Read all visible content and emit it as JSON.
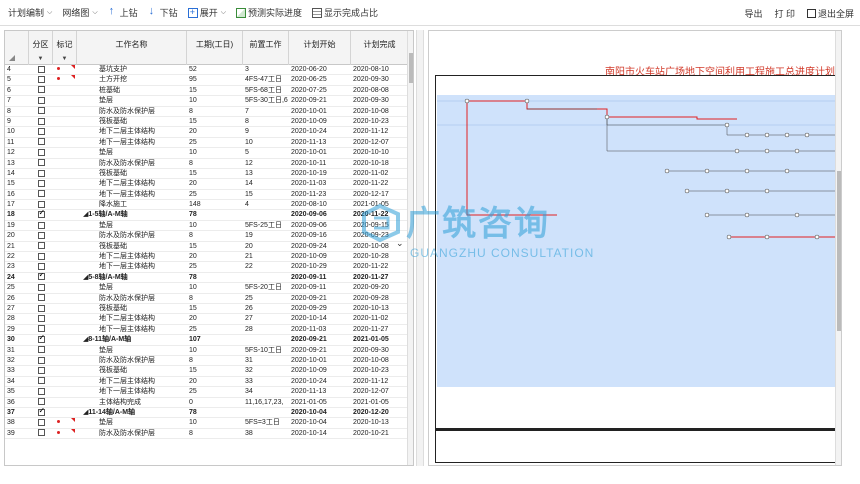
{
  "toolbar": {
    "plan_edit": "计划编制",
    "network": "网络图",
    "drill_up": "上钻",
    "drill_down": "下钻",
    "expand": "展开",
    "predict": "预测实际进度",
    "show_ratio": "显示完成占比",
    "export": "导出",
    "print": "打 印",
    "exit_full": "退出全屏"
  },
  "columns": {
    "part": "分区",
    "mark": "标记",
    "name": "工作名称",
    "duration": "工期(工日)",
    "predecessor": "前置工作",
    "start": "计划开始",
    "end": "计划完成"
  },
  "rows": [
    {
      "n": "4",
      "name": "基坑支护",
      "dur": "52",
      "pre": "3",
      "start": "2020-06-20",
      "end": "2020-08-10",
      "mark": true,
      "bold": false,
      "check": false
    },
    {
      "n": "5",
      "name": "土方开挖",
      "dur": "95",
      "pre": "4FS-47工日",
      "start": "2020-06-25",
      "end": "2020-09-30",
      "mark": true,
      "bold": false,
      "check": false
    },
    {
      "n": "6",
      "name": "桩基础",
      "dur": "15",
      "pre": "5FS-68工日",
      "start": "2020-07-25",
      "end": "2020-08-08",
      "mark": false,
      "bold": false,
      "check": false
    },
    {
      "n": "7",
      "name": "垫层",
      "dur": "10",
      "pre": "5FS-30工日,6",
      "start": "2020-09-21",
      "end": "2020-09-30",
      "mark": false,
      "bold": false,
      "check": false
    },
    {
      "n": "8",
      "name": "防水及防水保护层",
      "dur": "8",
      "pre": "7",
      "start": "2020-10-01",
      "end": "2020-10-08",
      "mark": false,
      "bold": false,
      "check": false
    },
    {
      "n": "9",
      "name": "筏板基础",
      "dur": "15",
      "pre": "8",
      "start": "2020-10-09",
      "end": "2020-10-23",
      "mark": false,
      "bold": false,
      "check": false
    },
    {
      "n": "10",
      "name": "地下二层主体结构",
      "dur": "20",
      "pre": "9",
      "start": "2020-10-24",
      "end": "2020-11-12",
      "mark": false,
      "bold": false,
      "check": false
    },
    {
      "n": "11",
      "name": "地下一层主体结构",
      "dur": "25",
      "pre": "10",
      "start": "2020-11-13",
      "end": "2020-12-07",
      "mark": false,
      "bold": false,
      "check": false
    },
    {
      "n": "12",
      "name": "垫层",
      "dur": "10",
      "pre": "5",
      "start": "2020-10-01",
      "end": "2020-10-10",
      "mark": false,
      "bold": false,
      "check": false
    },
    {
      "n": "13",
      "name": "防水及防水保护层",
      "dur": "8",
      "pre": "12",
      "start": "2020-10-11",
      "end": "2020-10-18",
      "mark": false,
      "bold": false,
      "check": false
    },
    {
      "n": "14",
      "name": "筏板基础",
      "dur": "15",
      "pre": "13",
      "start": "2020-10-19",
      "end": "2020-11-02",
      "mark": false,
      "bold": false,
      "check": false
    },
    {
      "n": "15",
      "name": "地下二层主体结构",
      "dur": "20",
      "pre": "14",
      "start": "2020-11-03",
      "end": "2020-11-22",
      "mark": false,
      "bold": false,
      "check": false
    },
    {
      "n": "16",
      "name": "地下一层主体结构",
      "dur": "25",
      "pre": "15",
      "start": "2020-11-23",
      "end": "2020-12-17",
      "mark": false,
      "bold": false,
      "check": false
    },
    {
      "n": "17",
      "name": "降水施工",
      "dur": "148",
      "pre": "4",
      "start": "2020-08-10",
      "end": "2021-01-05",
      "mark": false,
      "bold": false,
      "check": false
    },
    {
      "n": "18",
      "name": "◢1-5轴/A-M轴",
      "dur": "78",
      "pre": "",
      "start": "2020-09-06",
      "end": "2020-11-22",
      "mark": false,
      "bold": true,
      "check": true
    },
    {
      "n": "19",
      "name": "垫层",
      "dur": "10",
      "pre": "5FS-25工日",
      "start": "2020-09-06",
      "end": "2020-09-15",
      "mark": false,
      "bold": false,
      "check": false
    },
    {
      "n": "20",
      "name": "防水及防水保护层",
      "dur": "8",
      "pre": "19",
      "start": "2020-09-16",
      "end": "2020-09-23",
      "mark": false,
      "bold": false,
      "check": false
    },
    {
      "n": "21",
      "name": "筏板基础",
      "dur": "15",
      "pre": "20",
      "start": "2020-09-24",
      "end": "2020-10-08",
      "mark": false,
      "bold": false,
      "check": false
    },
    {
      "n": "22",
      "name": "地下二层主体结构",
      "dur": "20",
      "pre": "21",
      "start": "2020-10-09",
      "end": "2020-10-28",
      "mark": false,
      "bold": false,
      "check": false
    },
    {
      "n": "23",
      "name": "地下一层主体结构",
      "dur": "25",
      "pre": "22",
      "start": "2020-10-29",
      "end": "2020-11-22",
      "mark": false,
      "bold": false,
      "check": false
    },
    {
      "n": "24",
      "name": "◢5-8轴/A-M轴",
      "dur": "78",
      "pre": "",
      "start": "2020-09-11",
      "end": "2020-11-27",
      "mark": false,
      "bold": true,
      "check": true
    },
    {
      "n": "25",
      "name": "垫层",
      "dur": "10",
      "pre": "5FS-20工日",
      "start": "2020-09-11",
      "end": "2020-09-20",
      "mark": false,
      "bold": false,
      "check": false
    },
    {
      "n": "26",
      "name": "防水及防水保护层",
      "dur": "8",
      "pre": "25",
      "start": "2020-09-21",
      "end": "2020-09-28",
      "mark": false,
      "bold": false,
      "check": false
    },
    {
      "n": "27",
      "name": "筏板基础",
      "dur": "15",
      "pre": "26",
      "start": "2020-09-29",
      "end": "2020-10-13",
      "mark": false,
      "bold": false,
      "check": false
    },
    {
      "n": "28",
      "name": "地下二层主体结构",
      "dur": "20",
      "pre": "27",
      "start": "2020-10-14",
      "end": "2020-11-02",
      "mark": false,
      "bold": false,
      "check": false
    },
    {
      "n": "29",
      "name": "地下一层主体结构",
      "dur": "25",
      "pre": "28",
      "start": "2020-11-03",
      "end": "2020-11-27",
      "mark": false,
      "bold": false,
      "check": false
    },
    {
      "n": "30",
      "name": "◢8-11轴/A-M轴",
      "dur": "107",
      "pre": "",
      "start": "2020-09-21",
      "end": "2021-01-05",
      "mark": false,
      "bold": true,
      "check": true
    },
    {
      "n": "31",
      "name": "垫层",
      "dur": "10",
      "pre": "5FS-10工日",
      "start": "2020-09-21",
      "end": "2020-09-30",
      "mark": false,
      "bold": false,
      "check": false
    },
    {
      "n": "32",
      "name": "防水及防水保护层",
      "dur": "8",
      "pre": "31",
      "start": "2020-10-01",
      "end": "2020-10-08",
      "mark": false,
      "bold": false,
      "check": false
    },
    {
      "n": "33",
      "name": "筏板基础",
      "dur": "15",
      "pre": "32",
      "start": "2020-10-09",
      "end": "2020-10-23",
      "mark": false,
      "bold": false,
      "check": false
    },
    {
      "n": "34",
      "name": "地下二层主体结构",
      "dur": "20",
      "pre": "33",
      "start": "2020-10-24",
      "end": "2020-11-12",
      "mark": false,
      "bold": false,
      "check": false
    },
    {
      "n": "35",
      "name": "地下一层主体结构",
      "dur": "25",
      "pre": "34",
      "start": "2020-11-13",
      "end": "2020-12-07",
      "mark": false,
      "bold": false,
      "check": false
    },
    {
      "n": "36",
      "name": "主体结构完成",
      "dur": "0",
      "pre": "11,16,17,23,",
      "start": "2021-01-05",
      "end": "2021-01-05",
      "mark": false,
      "bold": false,
      "check": false
    },
    {
      "n": "37",
      "name": "◢11-14轴/A-M轴",
      "dur": "78",
      "pre": "",
      "start": "2020-10-04",
      "end": "2020-12-20",
      "mark": false,
      "bold": true,
      "check": true
    },
    {
      "n": "38",
      "name": "垫层",
      "dur": "10",
      "pre": "5FS=3工日",
      "start": "2020-10-04",
      "end": "2020-10-13",
      "mark": true,
      "bold": false,
      "check": false
    },
    {
      "n": "39",
      "name": "防水及防水保护层",
      "dur": "8",
      "pre": "38",
      "start": "2020-10-14",
      "end": "2020-10-21",
      "mark": true,
      "bold": false,
      "check": false
    }
  ],
  "plan": {
    "title": "南阳市火车站广场地下空间利用工程施工总进度计划"
  },
  "watermark": {
    "cn": "广筑咨询",
    "en": "GUANGZHU CONSULTATION"
  },
  "colors": {
    "accent": "#2a6fd6",
    "plan_bg": "#cfe2fb",
    "critical": "#e02020",
    "title_red": "#d23a2a"
  }
}
